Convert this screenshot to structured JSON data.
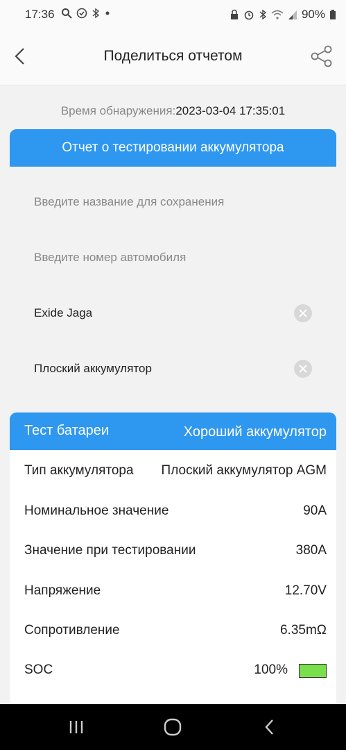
{
  "status_bar": {
    "time": "17:36",
    "battery": "90%"
  },
  "app_bar": {
    "title": "Поделиться отчетом",
    "back_icon": "back-arrow-icon",
    "share_icon": "share-icon"
  },
  "detection": {
    "label": "Время обнаружения:",
    "value": "2023-03-04 17:35:01"
  },
  "report": {
    "header": "Отчет о тестировании аккумулятора",
    "fields": [
      {
        "text": "Введите название для сохранения",
        "placeholder": true
      },
      {
        "text": "Введите номер автомобиля",
        "placeholder": true
      },
      {
        "text": "Exide Jaga",
        "placeholder": false
      },
      {
        "text": "Плоский аккумулятор",
        "placeholder": false
      }
    ]
  },
  "battery_test": {
    "title": "Тест батареи",
    "result": "Хороший аккумулятор",
    "rows": [
      {
        "key": "Тип аккумулятора",
        "value": "Плоский аккумулятор AGM"
      },
      {
        "key": "Номинальное значение",
        "value": "90A"
      },
      {
        "key": "Значение при тестировании",
        "value": "380A"
      },
      {
        "key": "Напряжение",
        "value": "12.70V"
      },
      {
        "key": "Сопротивление",
        "value": "6.35mΩ"
      },
      {
        "key": "SOC",
        "value": "100%"
      }
    ],
    "soc_level": 1.0,
    "soc_color": "#79e04b"
  },
  "colors": {
    "accent": "#2e97f0"
  }
}
